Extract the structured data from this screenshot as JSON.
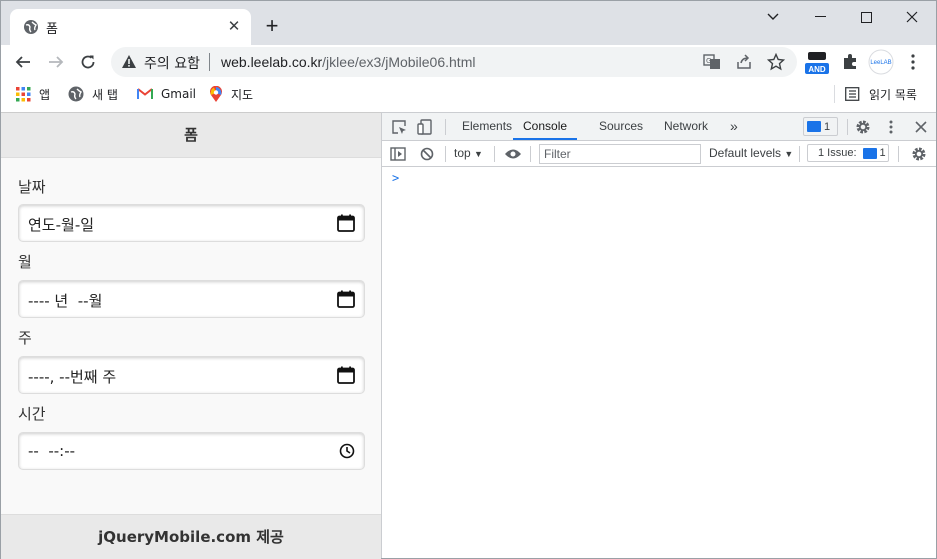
{
  "browser": {
    "tab_title": "폼",
    "security_label": "주의 요함",
    "url_host": "web.leelab.co.kr",
    "url_path": "/jklee/ex3/jMobile06.html",
    "profile_text": "LeeLAB",
    "ext_badge": "AND"
  },
  "bookmarks": {
    "items": [
      {
        "label": "앱",
        "icon": "apps-grid-icon"
      },
      {
        "label": "새 탭",
        "icon": "globe-icon"
      },
      {
        "label": "Gmail",
        "icon": "gmail-icon"
      },
      {
        "label": "지도",
        "icon": "maps-pin-icon"
      }
    ],
    "reading_list": "읽기 목록"
  },
  "page": {
    "header": "폼",
    "fields": [
      {
        "label": "날짜",
        "value": "연도-월-일",
        "picker_icon": "calendar-icon"
      },
      {
        "label": "월",
        "value": "---- 년  --월",
        "picker_icon": "calendar-icon"
      },
      {
        "label": "주",
        "value": "----, --번째 주",
        "picker_icon": "calendar-icon"
      },
      {
        "label": "시간",
        "value": "--  --:--",
        "picker_icon": "clock-icon"
      }
    ],
    "footer": "jQueryMobile.com 제공"
  },
  "devtools": {
    "tabs": [
      "Elements",
      "Console",
      "Sources",
      "Network"
    ],
    "active_tab": "Console",
    "more_tabs": "»",
    "message_count": "1",
    "context": "top",
    "filter_placeholder": "Filter",
    "levels": "Default levels",
    "issues_label": "1 Issue:",
    "issues_count": "1",
    "prompt": ">"
  },
  "colors": {
    "accent": "#1a73e8",
    "tabstrip": "#dee1e6",
    "jqm_bar": "#e9e9e9"
  }
}
